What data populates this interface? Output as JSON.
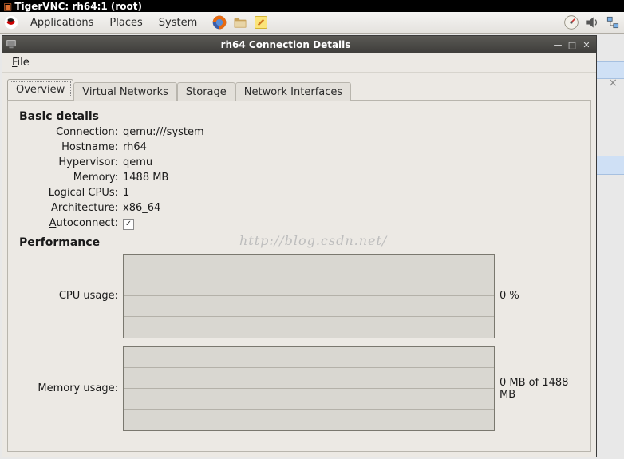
{
  "vnc": {
    "title": "TigerVNC: rh64:1 (root)"
  },
  "panel": {
    "menus": [
      "Applications",
      "Places",
      "System"
    ],
    "launchers": [
      {
        "name": "firefox-icon"
      },
      {
        "name": "file-manager-icon"
      },
      {
        "name": "text-editor-icon"
      }
    ],
    "tray": [
      {
        "name": "cpu-meter-icon"
      },
      {
        "name": "volume-icon"
      },
      {
        "name": "network-icon"
      }
    ]
  },
  "dialog": {
    "title": "rh64 Connection Details",
    "menubar": {
      "file": "File"
    },
    "tabs": [
      "Overview",
      "Virtual Networks",
      "Storage",
      "Network Interfaces"
    ],
    "overview": {
      "basic_head": "Basic details",
      "conn_label": "Connection:",
      "conn_value": "qemu:///system",
      "host_label": "Hostname:",
      "host_value": "rh64",
      "hyper_label": "Hypervisor:",
      "hyper_value": "qemu",
      "mem_label": "Memory:",
      "mem_value": "1488 MB",
      "cpu_label": "Logical CPUs:",
      "cpu_value": "1",
      "arch_label": "Architecture:",
      "arch_value": "x86_64",
      "auto_label_pre": "A",
      "auto_label_main": "utoconnect:",
      "auto_checked": "✓",
      "perf_head": "Performance",
      "cpuu_label": "CPU usage:",
      "cpuu_value": "0 %",
      "memu_label": "Memory usage:",
      "memu_value": "0 MB of 1488 MB"
    }
  },
  "watermark": "http://blog.csdn.net/",
  "bg_close": "×"
}
